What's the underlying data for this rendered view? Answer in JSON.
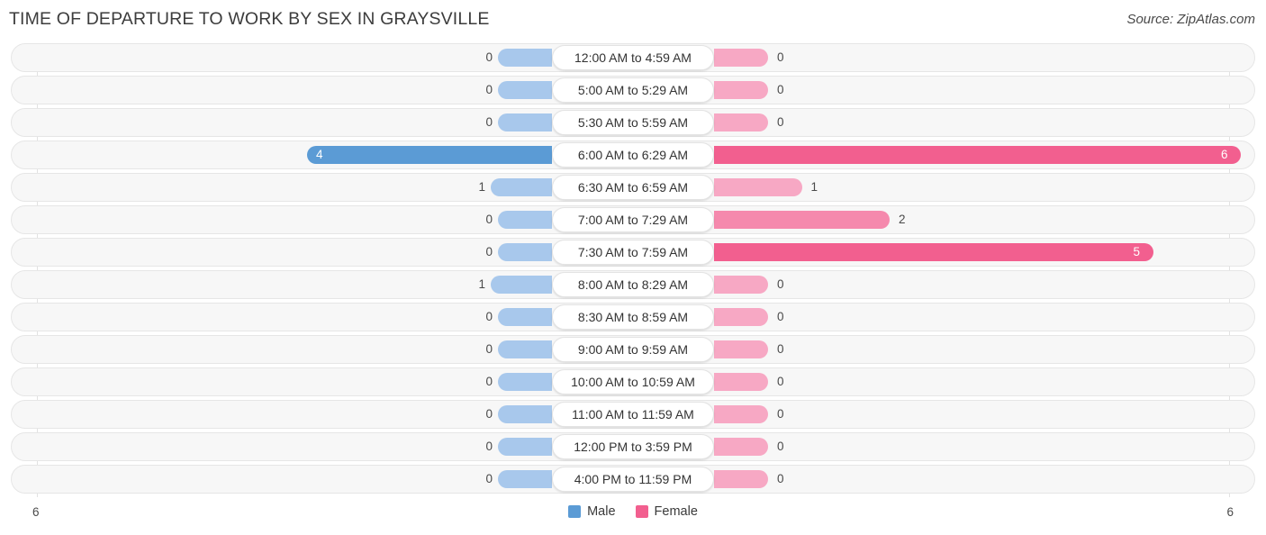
{
  "header": {
    "title": "TIME OF DEPARTURE TO WORK BY SEX IN GRAYSVILLE",
    "source": "Source: ZipAtlas.com"
  },
  "legend": {
    "male_label": "Male",
    "female_label": "Female",
    "male_color": "#5b9bd5",
    "female_color": "#f25f8f"
  },
  "axis": {
    "left_end": "6",
    "right_end": "6",
    "max": 6
  },
  "chart_data": {
    "type": "bar",
    "orientation": "horizontal-diverging",
    "title": "TIME OF DEPARTURE TO WORK BY SEX IN GRAYSVILLE",
    "xlabel": "",
    "ylabel": "",
    "xlim": [
      6,
      6
    ],
    "grid": true,
    "legend_position": "bottom-center",
    "categories": [
      "12:00 AM to 4:59 AM",
      "5:00 AM to 5:29 AM",
      "5:30 AM to 5:59 AM",
      "6:00 AM to 6:29 AM",
      "6:30 AM to 6:59 AM",
      "7:00 AM to 7:29 AM",
      "7:30 AM to 7:59 AM",
      "8:00 AM to 8:29 AM",
      "8:30 AM to 8:59 AM",
      "9:00 AM to 9:59 AM",
      "10:00 AM to 10:59 AM",
      "11:00 AM to 11:59 AM",
      "12:00 PM to 3:59 PM",
      "4:00 PM to 11:59 PM"
    ],
    "series": [
      {
        "name": "Male",
        "values": [
          0,
          0,
          0,
          4,
          1,
          0,
          0,
          1,
          0,
          0,
          0,
          0,
          0,
          0
        ]
      },
      {
        "name": "Female",
        "values": [
          0,
          0,
          0,
          6,
          1,
          2,
          5,
          0,
          0,
          0,
          0,
          0,
          0,
          0
        ]
      }
    ]
  },
  "rows": [
    {
      "label": "12:00 AM to 4:59 AM",
      "male": "0",
      "female": "0",
      "male_v": 0,
      "female_v": 0
    },
    {
      "label": "5:00 AM to 5:29 AM",
      "male": "0",
      "female": "0",
      "male_v": 0,
      "female_v": 0
    },
    {
      "label": "5:30 AM to 5:59 AM",
      "male": "0",
      "female": "0",
      "male_v": 0,
      "female_v": 0
    },
    {
      "label": "6:00 AM to 6:29 AM",
      "male": "4",
      "female": "6",
      "male_v": 4,
      "female_v": 6
    },
    {
      "label": "6:30 AM to 6:59 AM",
      "male": "1",
      "female": "1",
      "male_v": 1,
      "female_v": 1
    },
    {
      "label": "7:00 AM to 7:29 AM",
      "male": "0",
      "female": "2",
      "male_v": 0,
      "female_v": 2
    },
    {
      "label": "7:30 AM to 7:59 AM",
      "male": "0",
      "female": "5",
      "male_v": 0,
      "female_v": 5
    },
    {
      "label": "8:00 AM to 8:29 AM",
      "male": "1",
      "female": "0",
      "male_v": 1,
      "female_v": 0
    },
    {
      "label": "8:30 AM to 8:59 AM",
      "male": "0",
      "female": "0",
      "male_v": 0,
      "female_v": 0
    },
    {
      "label": "9:00 AM to 9:59 AM",
      "male": "0",
      "female": "0",
      "male_v": 0,
      "female_v": 0
    },
    {
      "label": "10:00 AM to 10:59 AM",
      "male": "0",
      "female": "0",
      "male_v": 0,
      "female_v": 0
    },
    {
      "label": "11:00 AM to 11:59 AM",
      "male": "0",
      "female": "0",
      "male_v": 0,
      "female_v": 0
    },
    {
      "label": "12:00 PM to 3:59 PM",
      "male": "0",
      "female": "0",
      "male_v": 0,
      "female_v": 0
    },
    {
      "label": "4:00 PM to 11:59 PM",
      "male": "0",
      "female": "0",
      "male_v": 0,
      "female_v": 0
    }
  ]
}
